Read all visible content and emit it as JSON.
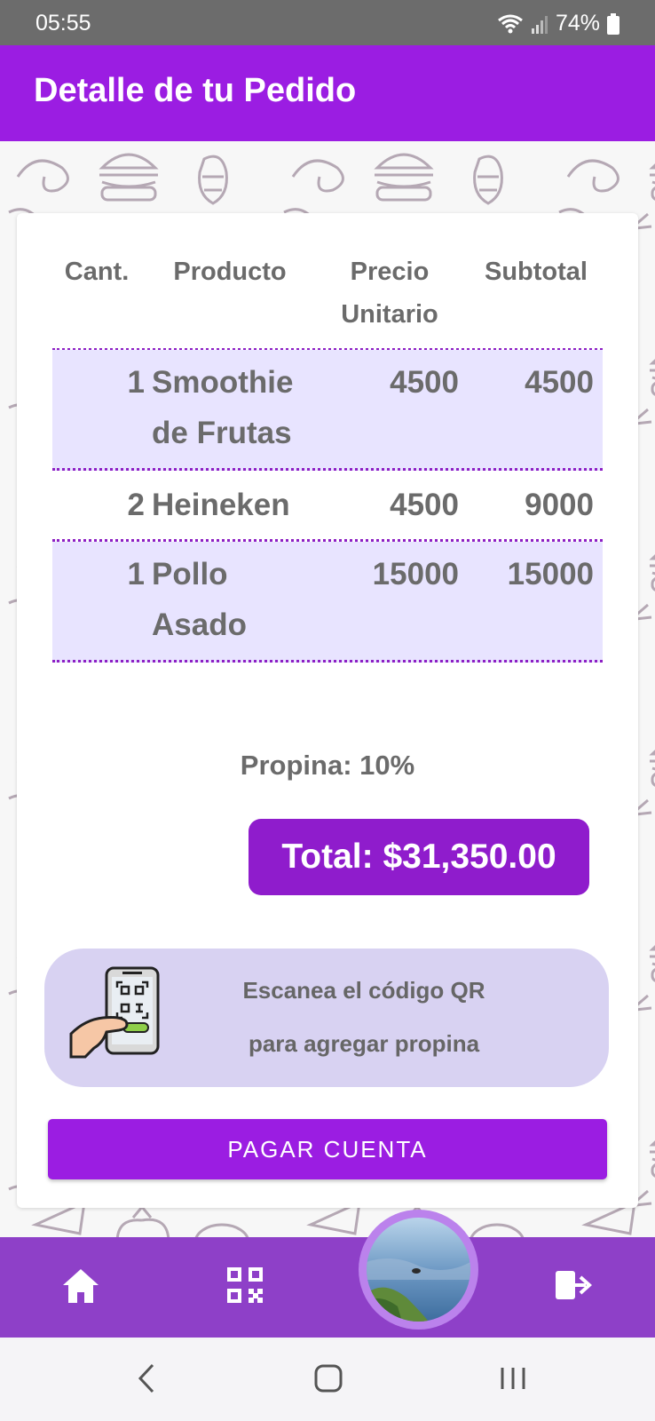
{
  "status": {
    "time": "05:55",
    "battery": "74%"
  },
  "app_bar": {
    "title": "Detalle de tu Pedido"
  },
  "table": {
    "headers": {
      "qty": "Cant.",
      "product": "Producto",
      "price_line1": "Precio",
      "price_line2": "Unitario",
      "subtotal": "Subtotal"
    },
    "rows": [
      {
        "qty": "1",
        "product_line1": "Smoothie",
        "product_line2": "de Frutas",
        "price": "4500",
        "subtotal": "4500"
      },
      {
        "qty": "2",
        "product_line1": "Heineken",
        "product_line2": "",
        "price": "4500",
        "subtotal": "9000"
      },
      {
        "qty": "1",
        "product_line1": "Pollo",
        "product_line2": "Asado",
        "price": "15000",
        "subtotal": "15000"
      }
    ]
  },
  "tip": "Propina: 10%",
  "total": "Total: $31,350.00",
  "qr_banner": {
    "line1": "Escanea el código QR",
    "line2": "para agregar propina"
  },
  "pay_button": "PAGAR CUENTA",
  "nav": {
    "items": [
      "home-icon",
      "qr-code-icon",
      "avatar",
      "logout-icon"
    ]
  },
  "colors": {
    "primary": "#9b1de2",
    "bottom_nav": "#8e40c8",
    "row_shade": "#e8e4ff",
    "total_bg": "#8f1ccc",
    "banner_bg": "#d8d2f2"
  }
}
